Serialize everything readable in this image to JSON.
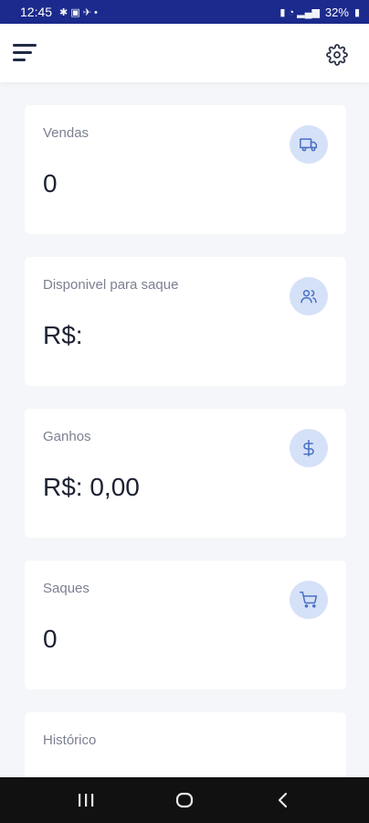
{
  "status_bar": {
    "time": "12:45",
    "battery": "32%"
  },
  "header": {
    "menu_icon": "hamburger-icon",
    "settings_icon": "gear-icon"
  },
  "cards": [
    {
      "label": "Vendas",
      "value": "0",
      "icon": "truck-icon"
    },
    {
      "label": "Disponivel para saque",
      "value": "R$:",
      "icon": "users-icon"
    },
    {
      "label": "Ganhos",
      "value": "R$: 0,00",
      "icon": "dollar-icon"
    },
    {
      "label": "Saques",
      "value": "0",
      "icon": "cart-icon"
    },
    {
      "label": "Histórico",
      "value": "",
      "icon": ""
    }
  ],
  "colors": {
    "status_bar": "#1b2a8c",
    "icon_circle": "#d5e1f7",
    "icon_stroke": "#4a6fc4"
  }
}
